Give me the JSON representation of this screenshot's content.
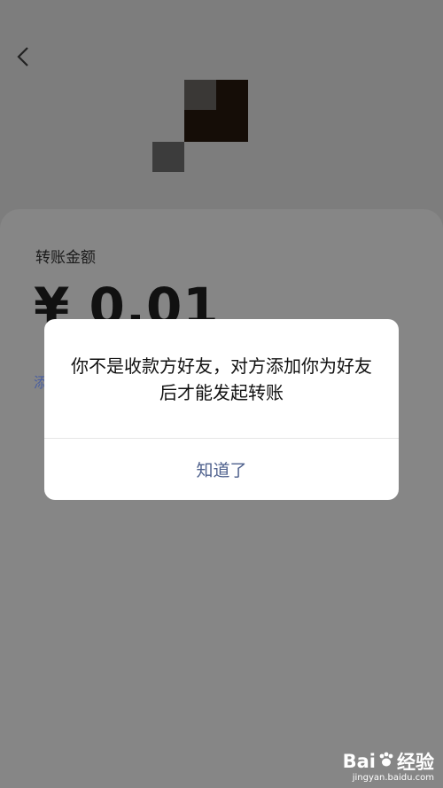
{
  "header": {
    "back_icon": "chevron-left-icon"
  },
  "transfer": {
    "amount_label": "转账金额",
    "amount": "¥ 0.01",
    "side_link_partial": "添"
  },
  "dialog": {
    "message": "你不是收款方好友，对方添加你为好友后才能发起转账",
    "confirm_label": "知道了"
  },
  "watermark": {
    "brand": "Bai",
    "brand_suffix": "经验",
    "url": "jingyan.baidu.com"
  },
  "colors": {
    "overlay_bg": "#7d7d7d",
    "dialog_button_text": "#4d5f8c",
    "link_color": "#4a5fa0"
  }
}
